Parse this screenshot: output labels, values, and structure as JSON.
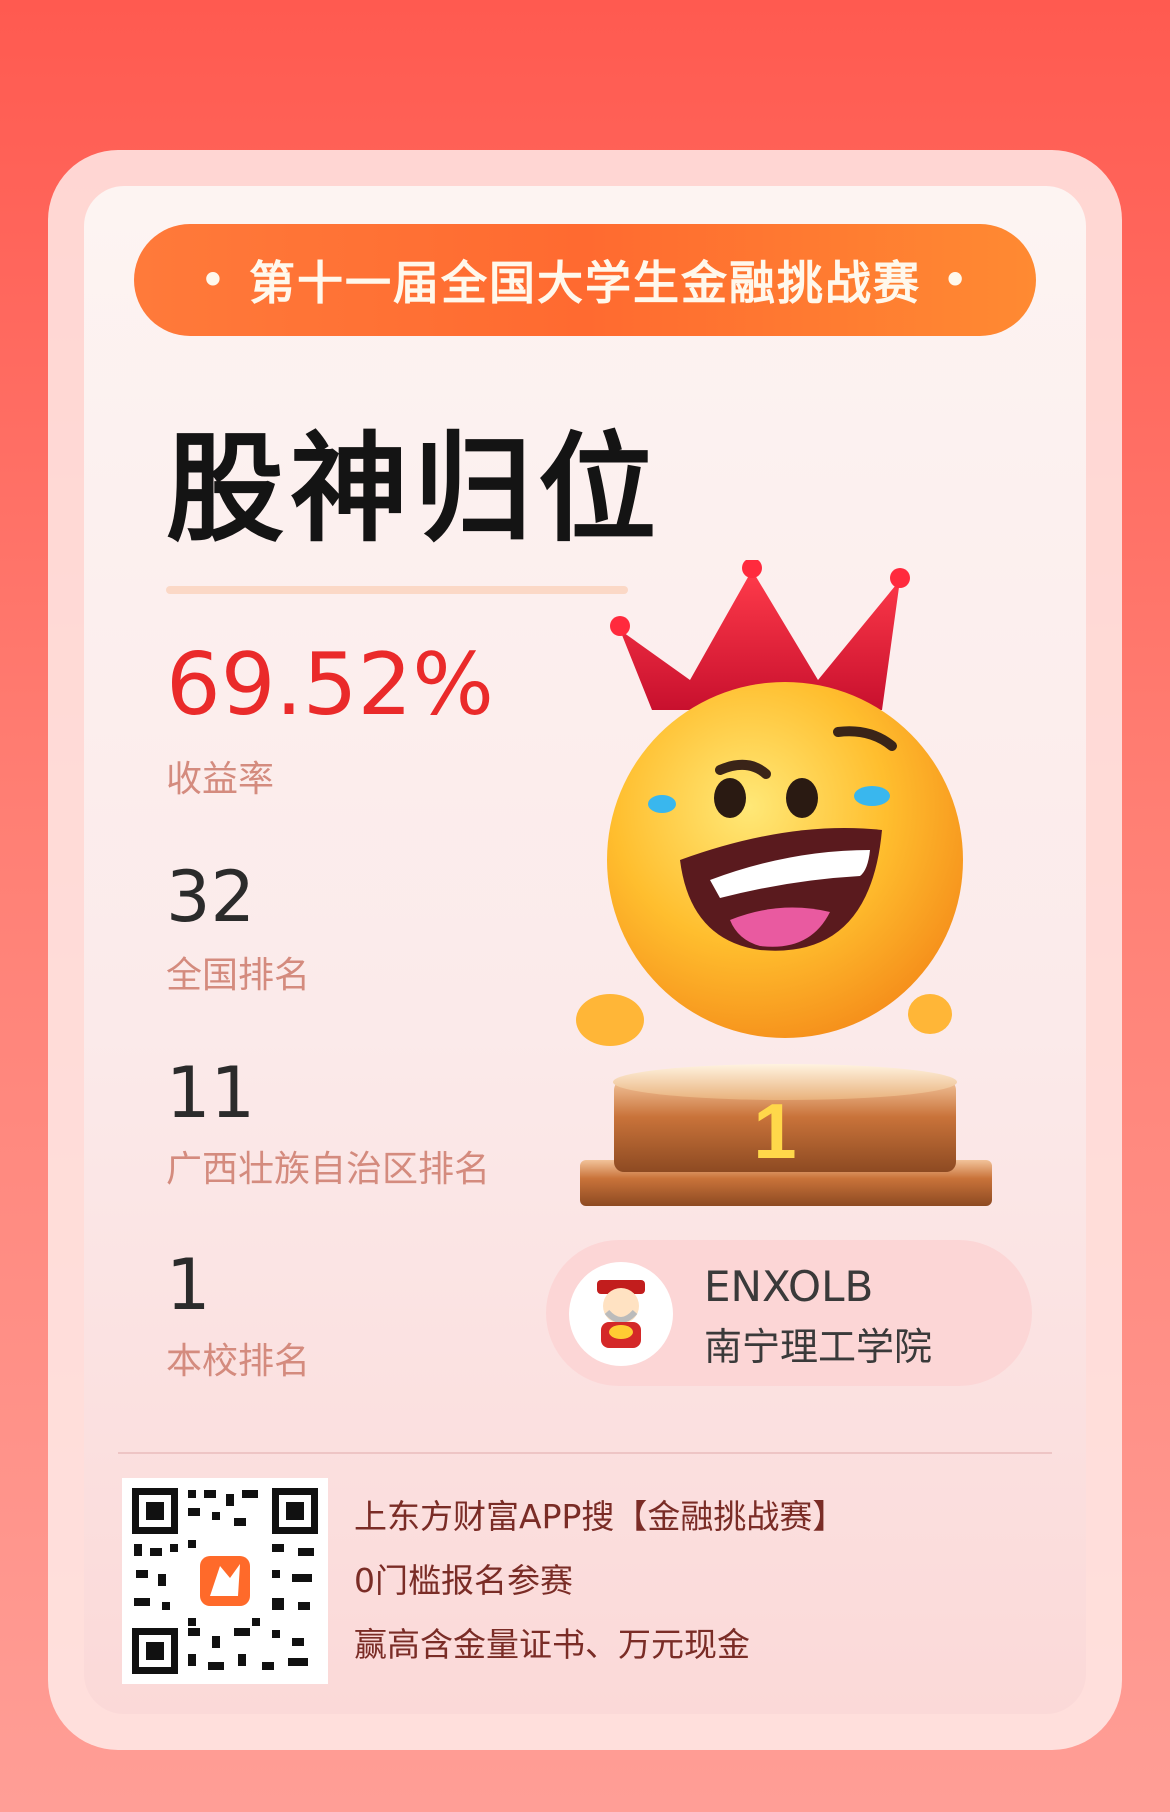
{
  "banner": {
    "dot_left": "•",
    "text": "第十一届全国大学生金融挑战赛",
    "dot_right": "•"
  },
  "title": "股神归位",
  "stats": {
    "return_rate": {
      "value": "69.52%",
      "label": "收益率"
    },
    "national_rank": {
      "value": "32",
      "label": "全国排名"
    },
    "region_rank": {
      "value": "11",
      "label": "广西壮族自治区排名"
    },
    "school_rank": {
      "value": "1",
      "label": "本校排名"
    }
  },
  "podium": {
    "number": "1"
  },
  "user": {
    "name": "ENXOLB",
    "school": "南宁理工学院"
  },
  "footer": {
    "line1": "上东方财富APP搜【金融挑战赛】",
    "line2": "0门槛报名参赛",
    "line3": "赢高含金量证书、万元现金"
  },
  "colors": {
    "accent_red": "#ea2a2a",
    "banner_orange": "#ff6a30",
    "label_pink": "#d48b7e"
  },
  "icons": {
    "mascot": "crowned-smiley-on-podium",
    "avatar": "god-of-wealth-avatar",
    "qr": "qr-code-with-app-logo"
  }
}
